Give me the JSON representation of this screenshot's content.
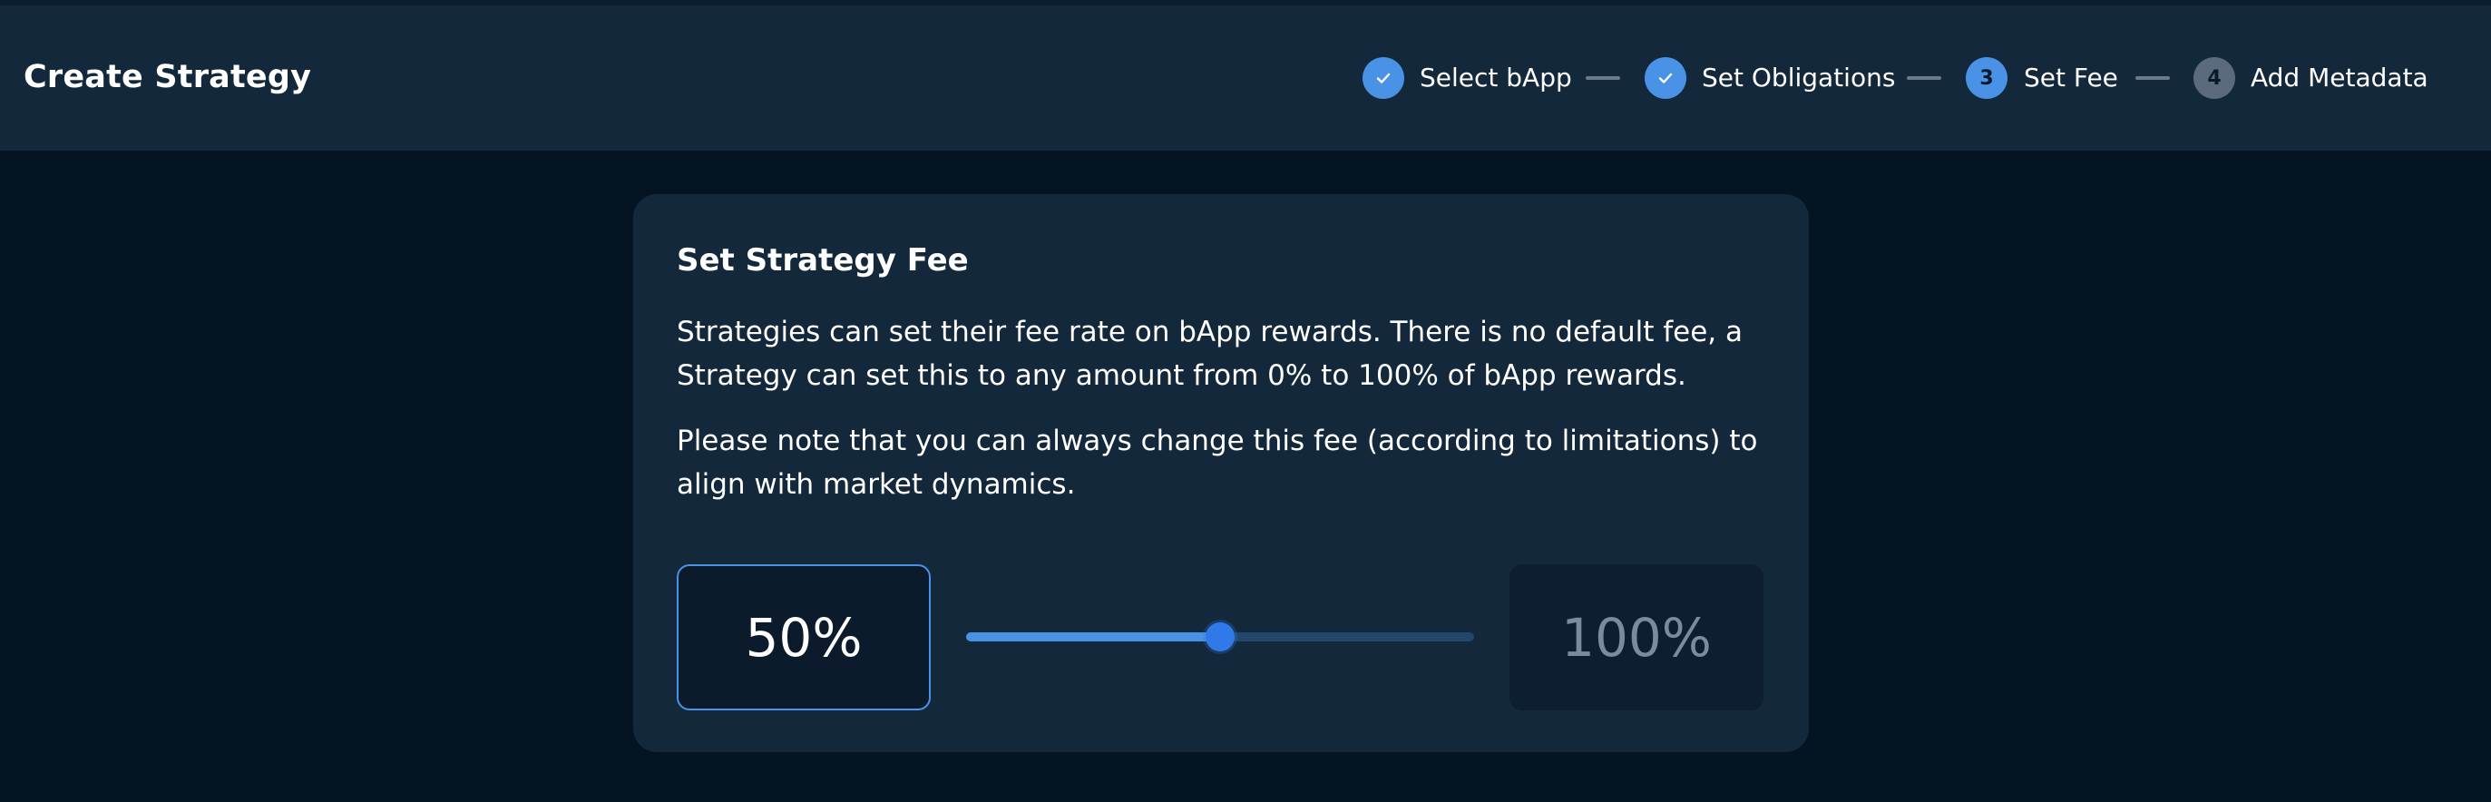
{
  "header": {
    "title": "Create Strategy"
  },
  "stepper": {
    "steps": [
      {
        "label": "Select bApp",
        "number": "1",
        "state": "done"
      },
      {
        "label": "Set Obligations",
        "number": "2",
        "state": "done"
      },
      {
        "label": "Set Fee",
        "number": "3",
        "state": "current"
      },
      {
        "label": "Add Metadata",
        "number": "4",
        "state": "todo"
      }
    ]
  },
  "card": {
    "title": "Set Strategy Fee",
    "paragraph_1": "Strategies can set their fee rate on bApp rewards. There is no default fee, a Strategy can set this to any amount from 0% to 100% of bApp rewards.",
    "paragraph_2": "Please note that you can always change this fee (according to limitations) to align with market dynamics.",
    "fee_value": "50%",
    "max_value": "100%",
    "slider_fraction": 0.5
  },
  "colors": {
    "accent": "#4a92e6",
    "background": "#051423",
    "panel": "#13283b"
  }
}
